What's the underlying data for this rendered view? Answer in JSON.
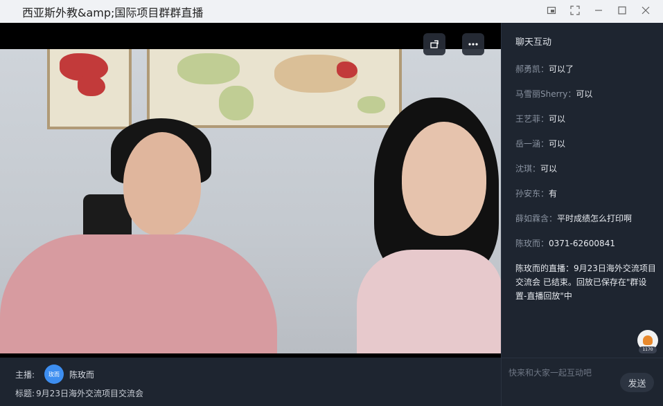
{
  "window": {
    "title": "西亚斯外教&amp;国际项目群群直播"
  },
  "chat": {
    "title": "聊天互动",
    "messages": [
      {
        "who": "郝勇凯：",
        "text": "可以了"
      },
      {
        "who": "马雪丽Sherry：",
        "text": "可以"
      },
      {
        "who": "王艺菲：",
        "text": "可以"
      },
      {
        "who": "岳一涵：",
        "text": "可以"
      },
      {
        "who": "沈琪：",
        "text": "可以"
      },
      {
        "who": "孙安东：",
        "text": "有"
      },
      {
        "who": "薛如霖含：",
        "text": "平时成绩怎么打印啊"
      },
      {
        "who": "陈玫而：",
        "text": "0371-62600841"
      }
    ],
    "system_message": "陈玫而的直播：9月23日海外交流项目交流会 已结束。回放已保存在\"群设置-直播回放\"中",
    "gift_count": "1170",
    "input_placeholder": "快来和大家一起互动吧",
    "send_label": "发送"
  },
  "info": {
    "host_label": "主播:",
    "host_avatar_text": "玫而",
    "host_name": "陈玫而",
    "topic_label": "标题:",
    "topic": "9月23日海外交流项目交流会"
  },
  "colors": {
    "panel_bg": "#1e2530",
    "avatar": "#3d8ef0",
    "titlebar": "#f0f2f5"
  }
}
